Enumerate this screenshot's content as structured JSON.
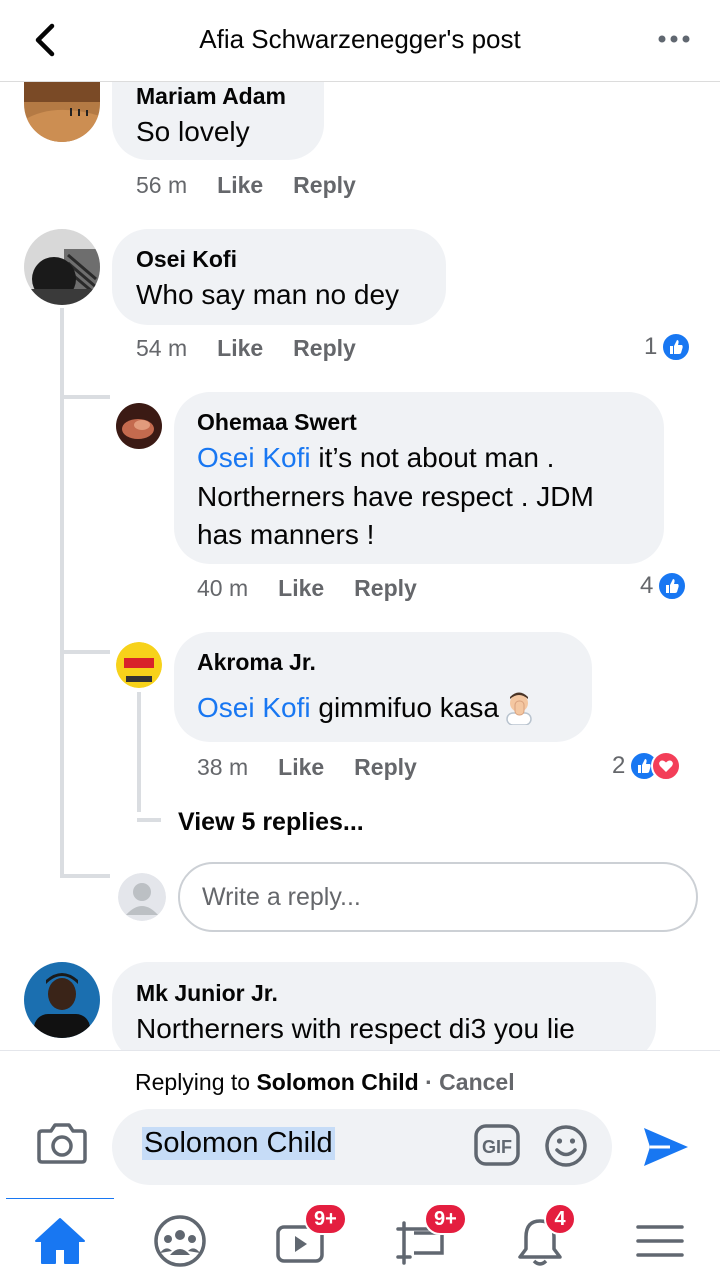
{
  "header": {
    "title": "Afia Schwarzenegger's post"
  },
  "comments": [
    {
      "author": "Mariam Adam",
      "text": "So lovely",
      "time": "56 m",
      "like": "Like",
      "reply": "Reply"
    },
    {
      "author": "Osei Kofi",
      "text": "Who say man no dey",
      "time": "54 m",
      "like": "Like",
      "reply": "Reply",
      "reaction_count": "1"
    },
    {
      "author": "Ohemaa Swert",
      "mention": "Osei Kofi",
      "text_line1": " it’s not about man .",
      "text_line2": "Northerners have respect . JDM",
      "text_line3": "has manners !",
      "time": "40 m",
      "like": "Like",
      "reply": "Reply",
      "reaction_count": "4"
    },
    {
      "author": "Akroma Jr.",
      "mention": "Osei Kofi",
      "text": " gimmifuo kasa",
      "time": "38 m",
      "like": "Like",
      "reply": "Reply",
      "reaction_count": "2"
    },
    {
      "author": "Mk Junior Jr.",
      "text": "Northerners with respect di3 you lie"
    }
  ],
  "view_replies": "View 5 replies...",
  "reply_placeholder": "Write a reply...",
  "composer": {
    "replying_prefix": "Replying to ",
    "replying_name": "Solomon Child",
    "cancel": " · Cancel",
    "value": "Solomon Child"
  },
  "nav": {
    "video_badge": "9+",
    "feeds_badge": "9+",
    "notifications_badge": "4"
  },
  "icons": [
    "back-icon",
    "more-icon",
    "camera-icon",
    "gif-icon",
    "emoji-icon",
    "send-icon",
    "home-icon",
    "groups-icon",
    "watch-icon",
    "feeds-icon",
    "bell-icon",
    "menu-icon",
    "like-icon",
    "love-icon"
  ],
  "colors": {
    "accent": "#1877f2",
    "bubble": "#f0f2f5",
    "badge": "#e41e3f",
    "love": "#f33e58"
  }
}
